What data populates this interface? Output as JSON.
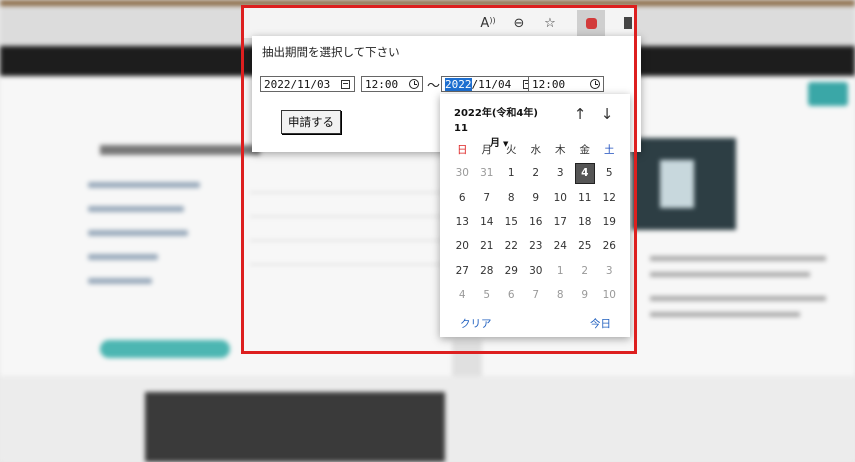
{
  "dialog": {
    "title": "抽出期間を選択して下さい",
    "start_date_value": "2022/11/03",
    "start_time_value": "12:00",
    "separator": "～",
    "end_date_year_selected": "2022",
    "end_date_rest": "/11/04",
    "end_time_value": "12:00",
    "apply_button_label": "申請する"
  },
  "toolbar": {
    "icons": [
      "read-aloud-icon",
      "zoom-out-icon",
      "favorites-add-icon",
      "extension-icon",
      "extension-2-icon"
    ],
    "read_aloud_glyph": "A",
    "zoom_glyph": "⊖",
    "fav_glyph": "☆"
  },
  "calendar": {
    "month_line1": "2022年(令和4年) 11",
    "month_line2": "月",
    "nav_up": "↑",
    "nav_down": "↓",
    "weekdays": [
      "日",
      "月",
      "火",
      "水",
      "木",
      "金",
      "土"
    ],
    "days": [
      [
        "30",
        "31",
        "1",
        "2",
        "3",
        "4",
        "5"
      ],
      [
        "6",
        "7",
        "8",
        "9",
        "10",
        "11",
        "12"
      ],
      [
        "13",
        "14",
        "15",
        "16",
        "17",
        "18",
        "19"
      ],
      [
        "20",
        "21",
        "22",
        "23",
        "24",
        "25",
        "26"
      ],
      [
        "27",
        "28",
        "29",
        "30",
        "1",
        "2",
        "3"
      ],
      [
        "4",
        "5",
        "6",
        "7",
        "8",
        "9",
        "10"
      ]
    ],
    "selected_day": "4",
    "clear_label": "クリア",
    "today_label": "今日"
  },
  "colors": {
    "highlight_frame": "#dd1f1f",
    "selection": "#1e6fd0",
    "link": "#1f5fbf",
    "sunday": "#dd2222",
    "saturday": "#1f4fbf"
  }
}
